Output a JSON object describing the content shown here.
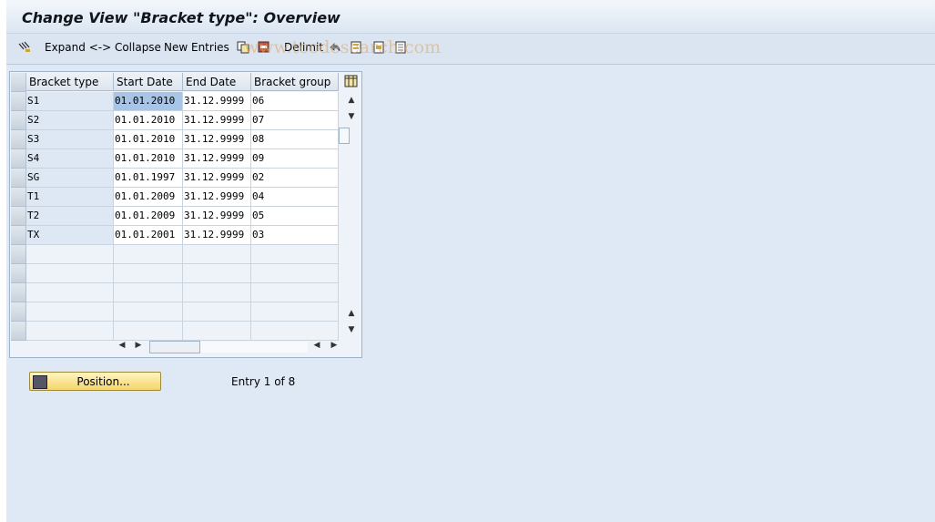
{
  "title": "Change View \"Bracket type\": Overview",
  "toolbar": {
    "expand_collapse": "Expand <-> Collapse",
    "new_entries": "New Entries",
    "delimit": "Delimit"
  },
  "watermark": "www.tcodesearch.com",
  "table": {
    "headers": [
      "Bracket type",
      "Start Date",
      "End Date",
      "Bracket group"
    ],
    "rows": [
      [
        "S1",
        "01.01.2010",
        "31.12.9999",
        "06"
      ],
      [
        "S2",
        "01.01.2010",
        "31.12.9999",
        "07"
      ],
      [
        "S3",
        "01.01.2010",
        "31.12.9999",
        "08"
      ],
      [
        "S4",
        "01.01.2010",
        "31.12.9999",
        "09"
      ],
      [
        "SG",
        "01.01.1997",
        "31.12.9999",
        "02"
      ],
      [
        "T1",
        "01.01.2009",
        "31.12.9999",
        "04"
      ],
      [
        "T2",
        "01.01.2009",
        "31.12.9999",
        "05"
      ],
      [
        "TX",
        "01.01.2001",
        "31.12.9999",
        "03"
      ]
    ]
  },
  "position_button": "Position...",
  "entry_info": "Entry 1 of 8"
}
